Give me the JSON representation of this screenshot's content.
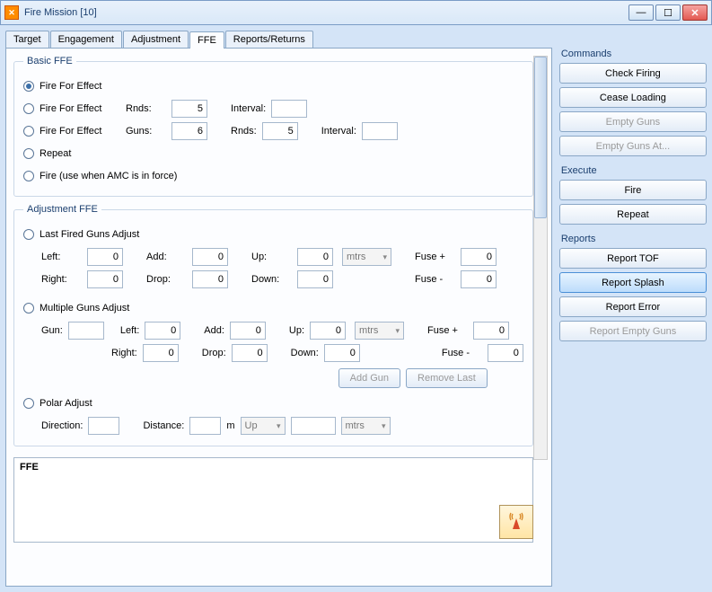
{
  "window": {
    "title": "Fire Mission [10]"
  },
  "tabs": [
    "Target",
    "Engagement",
    "Adjustment",
    "FFE",
    "Reports/Returns"
  ],
  "active_tab": "FFE",
  "basic_ffe": {
    "legend": "Basic FFE",
    "opt1": "Fire For Effect",
    "opt2": "Fire For Effect",
    "opt2_rnds_label": "Rnds:",
    "opt2_rnds": "5",
    "opt2_interval_label": "Interval:",
    "opt3": "Fire For Effect",
    "opt3_guns_label": "Guns:",
    "opt3_guns": "6",
    "opt3_rnds_label": "Rnds:",
    "opt3_rnds": "5",
    "opt3_interval_label": "Interval:",
    "opt4": "Repeat",
    "opt5": "Fire (use when AMC is in force)"
  },
  "adj_ffe": {
    "legend": "Adjustment FFE",
    "last_fired": "Last Fired Guns Adjust",
    "multiple": "Multiple Guns Adjust",
    "polar": "Polar Adjust",
    "left": "Left:",
    "right": "Right:",
    "add": "Add:",
    "drop": "Drop:",
    "up": "Up:",
    "down": "Down:",
    "fusep": "Fuse +",
    "fusem": "Fuse -",
    "gun": "Gun:",
    "mtrs": "mtrs",
    "upsel": "Up",
    "val0": "0",
    "add_gun": "Add Gun",
    "remove_last": "Remove Last",
    "direction": "Direction:",
    "distance": "Distance:",
    "m": "m"
  },
  "output": "FFE",
  "side": {
    "commands": {
      "label": "Commands",
      "check": "Check Firing",
      "cease": "Cease Loading",
      "empty": "Empty Guns",
      "emptyat": "Empty Guns At..."
    },
    "execute": {
      "label": "Execute",
      "fire": "Fire",
      "repeat": "Repeat"
    },
    "reports": {
      "label": "Reports",
      "tof": "Report TOF",
      "splash": "Report Splash",
      "error": "Report Error",
      "emptyguns": "Report Empty Guns"
    }
  }
}
